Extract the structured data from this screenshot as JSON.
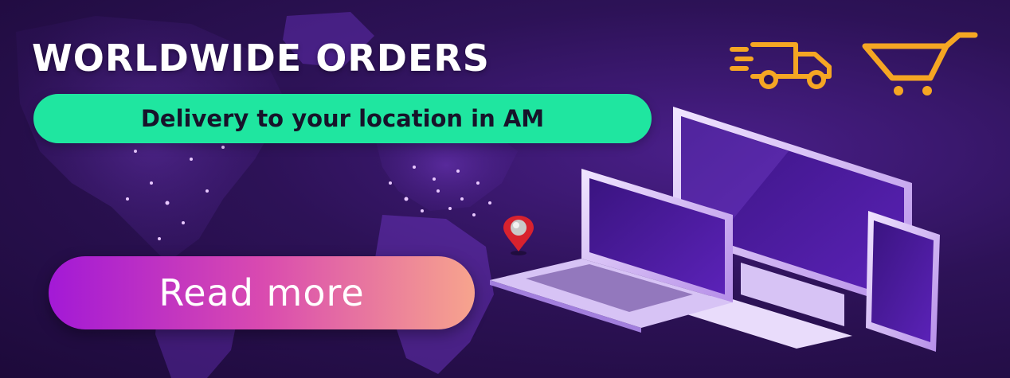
{
  "banner": {
    "headline": "WORLDWIDE ORDERS",
    "subline": "Delivery to your location in AM",
    "cta_label": "Read more"
  },
  "icons": [
    "delivery-truck-icon",
    "shopping-cart-icon",
    "location-pin-icon",
    "world-map",
    "devices-illustration"
  ],
  "colors": {
    "background": "#2d1257",
    "headline": "#ffffff",
    "pill": "#1fe6a0",
    "pill_text": "#17132a",
    "cta_gradient_start": "#a319d6",
    "cta_gradient_end": "#f7a48d",
    "icon_accent": "#f5a623",
    "pin": "#d8222e"
  }
}
